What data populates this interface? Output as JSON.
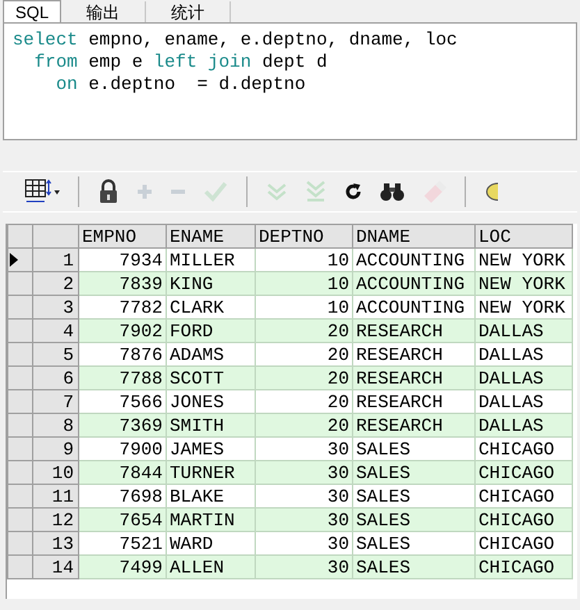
{
  "tabs": [
    {
      "label": "SQL",
      "selected": true
    },
    {
      "label": "输出",
      "selected": false
    },
    {
      "label": "统计",
      "selected": false
    }
  ],
  "sql": [
    [
      {
        "kind": "keyword",
        "text": "select"
      },
      {
        "kind": "plain",
        "text": " empno, ename, e.deptno, dname, loc"
      }
    ],
    [
      {
        "kind": "keyword",
        "text": "  from"
      },
      {
        "kind": "plain",
        "text": " emp e "
      },
      {
        "kind": "keyword",
        "text": "left join"
      },
      {
        "kind": "plain",
        "text": " dept d"
      }
    ],
    [
      {
        "kind": "keyword",
        "text": "    on"
      },
      {
        "kind": "plain",
        "text": " e.deptno  = d.deptno"
      }
    ]
  ],
  "toolbar": [
    {
      "kind": "grid",
      "disabled": false
    },
    {
      "kind": "lock",
      "disabled": false
    },
    {
      "kind": "plus",
      "disabled": true
    },
    {
      "kind": "minus",
      "disabled": true
    },
    {
      "kind": "check",
      "disabled": true
    },
    {
      "kind": "down",
      "disabled": true
    },
    {
      "kind": "last",
      "disabled": true
    },
    {
      "kind": "refresh",
      "disabled": false
    },
    {
      "kind": "find",
      "disabled": false
    },
    {
      "kind": "eraser",
      "disabled": true
    },
    {
      "kind": "more",
      "disabled": false
    }
  ],
  "table": {
    "columns": [
      "EMPNO",
      "ENAME",
      "DEPTNO",
      "DNAME",
      "LOC"
    ],
    "rows": [
      {
        "number": "1",
        "selected": true,
        "cells": [
          "7934",
          "MILLER",
          "10",
          "ACCOUNTING",
          "NEW YORK"
        ]
      },
      {
        "number": "2",
        "selected": false,
        "cells": [
          "7839",
          "KING",
          "10",
          "ACCOUNTING",
          "NEW YORK"
        ]
      },
      {
        "number": "3",
        "selected": false,
        "cells": [
          "7782",
          "CLARK",
          "10",
          "ACCOUNTING",
          "NEW YORK"
        ]
      },
      {
        "number": "4",
        "selected": false,
        "cells": [
          "7902",
          "FORD",
          "20",
          "RESEARCH",
          "DALLAS"
        ]
      },
      {
        "number": "5",
        "selected": false,
        "cells": [
          "7876",
          "ADAMS",
          "20",
          "RESEARCH",
          "DALLAS"
        ]
      },
      {
        "number": "6",
        "selected": false,
        "cells": [
          "7788",
          "SCOTT",
          "20",
          "RESEARCH",
          "DALLAS"
        ]
      },
      {
        "number": "7",
        "selected": false,
        "cells": [
          "7566",
          "JONES",
          "20",
          "RESEARCH",
          "DALLAS"
        ]
      },
      {
        "number": "8",
        "selected": false,
        "cells": [
          "7369",
          "SMITH",
          "20",
          "RESEARCH",
          "DALLAS"
        ]
      },
      {
        "number": "9",
        "selected": false,
        "cells": [
          "7900",
          "JAMES",
          "30",
          "SALES",
          "CHICAGO"
        ]
      },
      {
        "number": "10",
        "selected": false,
        "cells": [
          "7844",
          "TURNER",
          "30",
          "SALES",
          "CHICAGO"
        ]
      },
      {
        "number": "11",
        "selected": false,
        "cells": [
          "7698",
          "BLAKE",
          "30",
          "SALES",
          "CHICAGO"
        ]
      },
      {
        "number": "12",
        "selected": false,
        "cells": [
          "7654",
          "MARTIN",
          "30",
          "SALES",
          "CHICAGO"
        ]
      },
      {
        "number": "13",
        "selected": false,
        "cells": [
          "7521",
          "WARD",
          "30",
          "SALES",
          "CHICAGO"
        ]
      },
      {
        "number": "14",
        "selected": false,
        "cells": [
          "7499",
          "ALLEN",
          "30",
          "SALES",
          "CHICAGO"
        ]
      }
    ]
  }
}
